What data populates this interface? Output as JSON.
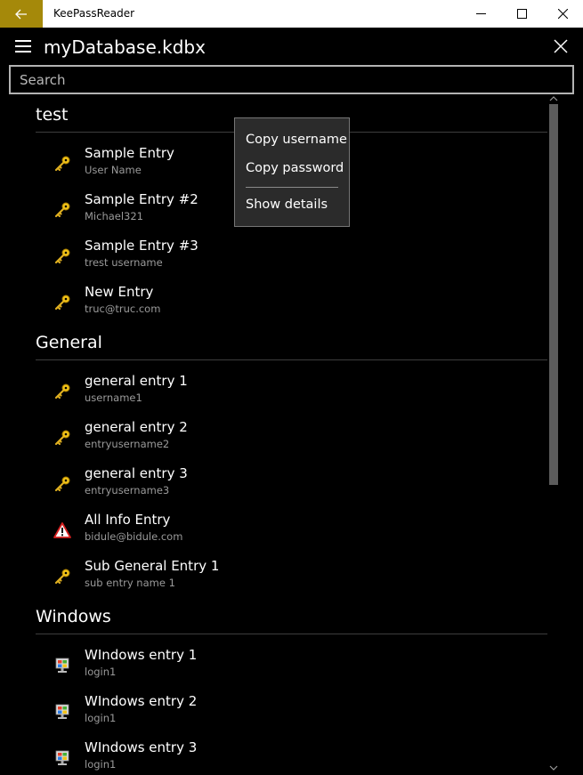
{
  "window": {
    "title": "KeePassReader",
    "back_icon": "arrow-left-icon",
    "accent": "#a5890a"
  },
  "header": {
    "db_title": "myDatabase.kdbx",
    "menu_icon": "hamburger-icon",
    "close_icon": "close-icon"
  },
  "search": {
    "placeholder": "Search",
    "value": ""
  },
  "groups": [
    {
      "name": "test",
      "entries": [
        {
          "name": "Sample Entry",
          "user": "User Name",
          "icon": "key-icon"
        },
        {
          "name": "Sample Entry #2",
          "user": "Michael321",
          "icon": "key-icon"
        },
        {
          "name": "Sample Entry #3",
          "user": "trest username",
          "icon": "key-icon"
        },
        {
          "name": "New Entry",
          "user": "truc@truc.com",
          "icon": "key-icon"
        }
      ]
    },
    {
      "name": "General",
      "entries": [
        {
          "name": "general entry 1",
          "user": "username1",
          "icon": "key-icon"
        },
        {
          "name": "general entry 2",
          "user": "entryusername2",
          "icon": "key-icon"
        },
        {
          "name": "general entry 3",
          "user": "entryusername3",
          "icon": "key-icon"
        },
        {
          "name": "All Info Entry",
          "user": "bidule@bidule.com",
          "icon": "warning-icon"
        },
        {
          "name": "Sub General Entry 1",
          "user": "sub entry name 1",
          "icon": "key-icon"
        }
      ]
    },
    {
      "name": "Windows",
      "entries": [
        {
          "name": "WIndows entry 1",
          "user": "login1",
          "icon": "windows-computer-icon"
        },
        {
          "name": "WIndows entry 2",
          "user": "login1",
          "icon": "windows-computer-icon"
        },
        {
          "name": "WIndows entry 3",
          "user": "login1",
          "icon": "windows-computer-icon"
        }
      ]
    }
  ],
  "context_menu": {
    "items": [
      "Copy username",
      "Copy password",
      "Show details"
    ]
  }
}
